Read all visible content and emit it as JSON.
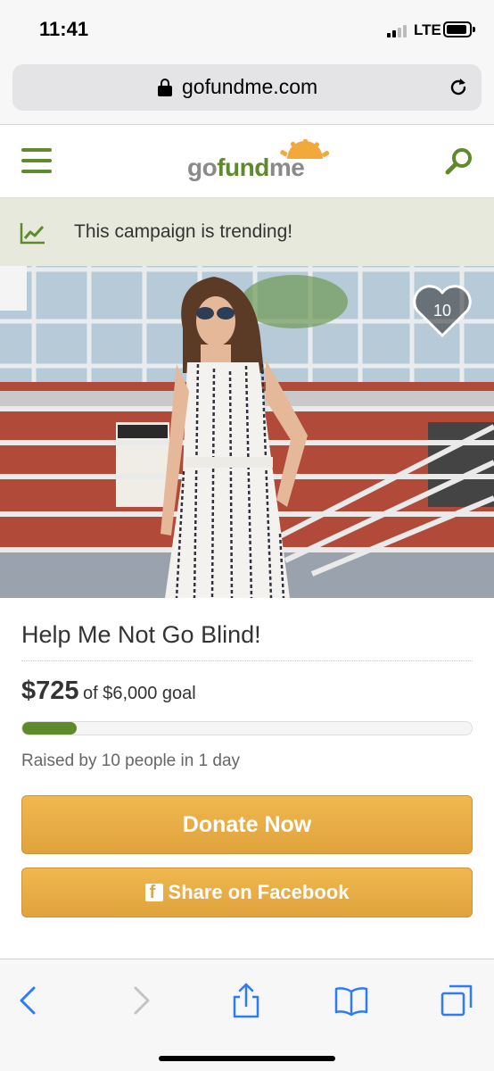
{
  "status_bar": {
    "time": "11:41",
    "network": "LTE"
  },
  "browser": {
    "url": "gofundme.com",
    "icons": [
      "lock-icon",
      "reload-icon"
    ]
  },
  "header": {
    "logo": {
      "go": "go",
      "fund": "fund",
      "me": "me"
    },
    "brand_color": "#5e8a2b",
    "icons": [
      "hamburger-menu-icon",
      "search-icon"
    ]
  },
  "trending": {
    "text": "This campaign is trending!",
    "icon": "trending-chart-icon"
  },
  "photo": {
    "heart_count": "10"
  },
  "campaign": {
    "title": "Help Me Not Go Blind!",
    "raised": "$725",
    "goal_text": "of $6,000 goal",
    "progress_fraction": 0.121,
    "raised_by": "Raised by 10 people in 1 day"
  },
  "buttons": {
    "donate": "Donate Now",
    "share": "Share on Facebook",
    "button_color": "#e2a63f"
  },
  "toolbar": {
    "icons": [
      "back-icon",
      "forward-icon",
      "share-icon",
      "bookmarks-icon",
      "tabs-icon"
    ],
    "accent_color": "#2f7bf5"
  }
}
